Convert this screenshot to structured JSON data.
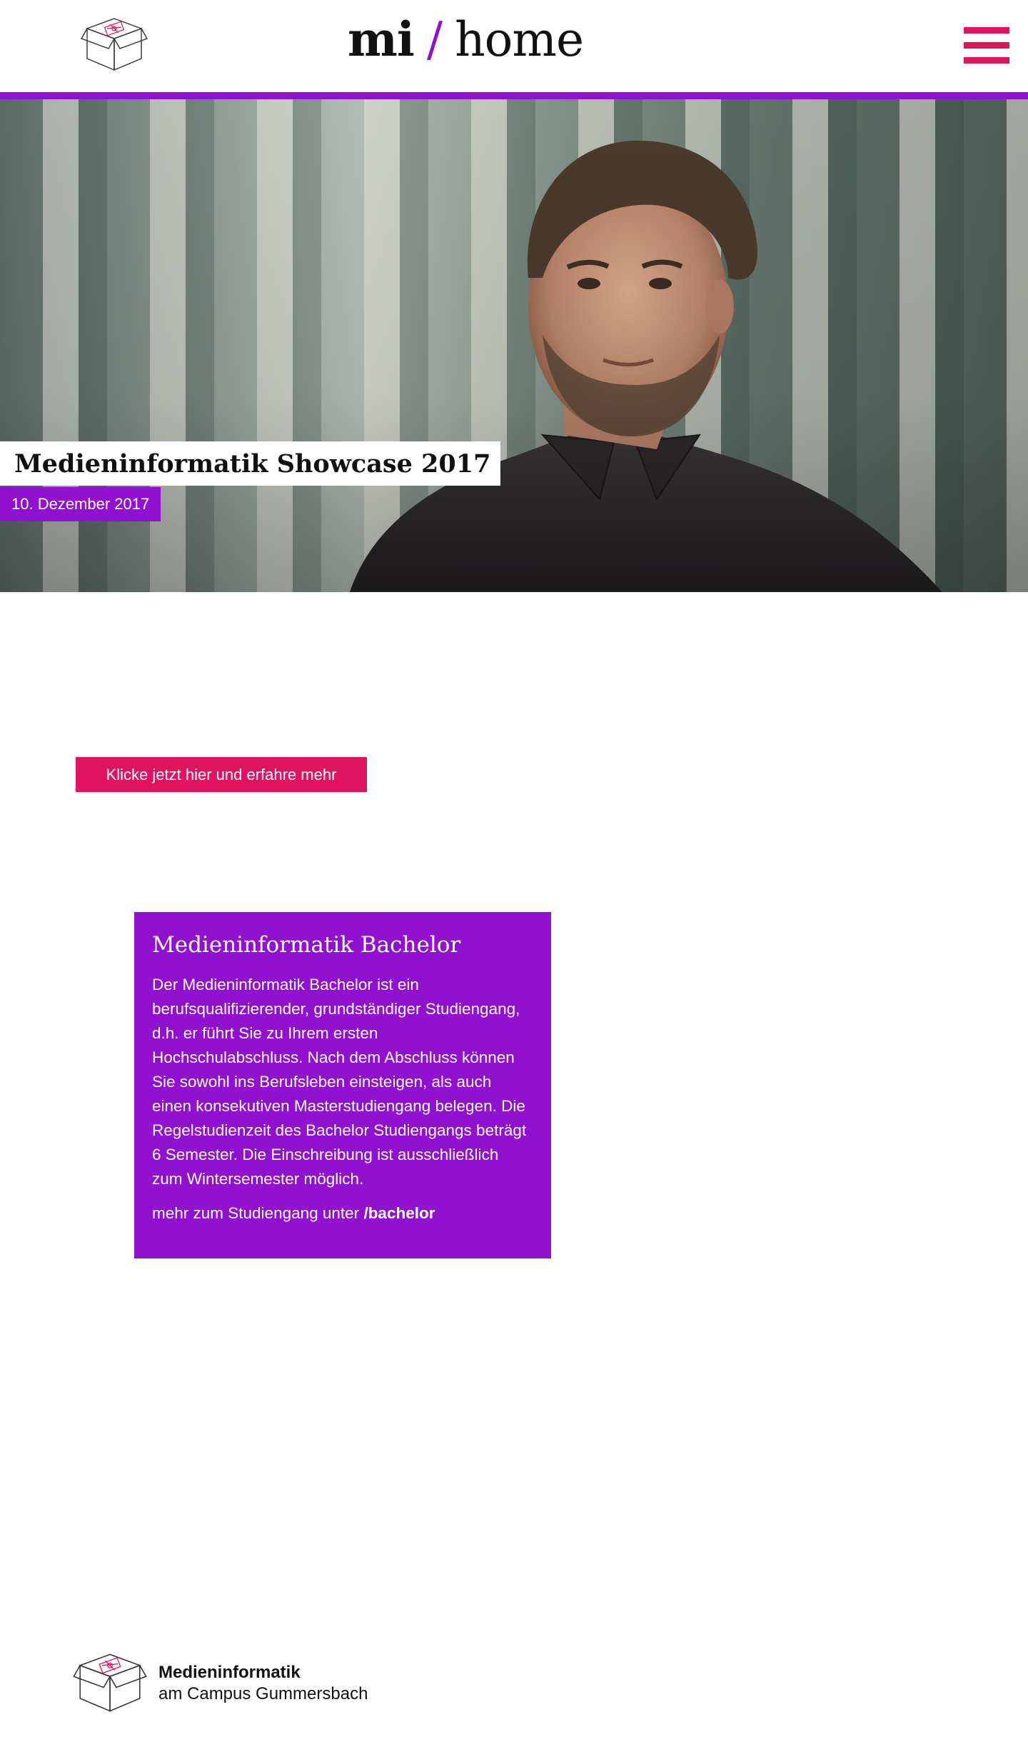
{
  "header": {
    "title_strong": "mi",
    "title_slash": "/",
    "title_light": "home"
  },
  "hero": {
    "title": "Medieninformatik Showcase 2017",
    "date": "10. Dezember 2017"
  },
  "cta": {
    "label": "Klicke jetzt hier und erfahre mehr"
  },
  "card": {
    "title": "Medieninformatik Bachelor",
    "text": "Der Medieninformatik Bachelor ist ein berufsqualifizierender, grundständiger Studiengang, d.h. er führt Sie zu Ihrem ersten Hochschulabschluss. Nach dem Abschluss können Sie sowohl ins Berufsleben einsteigen, als auch einen konsekutiven Masterstudiengang belegen. Die Regelstudienzeit des Bachelor Studiengangs beträgt 6 Semester. Die Einschreibung ist ausschließlich zum Wintersemester möglich.",
    "more_prefix": "mehr zum Studiengang unter",
    "more_link": "/bachelor"
  },
  "footer": {
    "name": "Medieninformatik",
    "subtitle": "am Campus Gummersbach"
  },
  "colors": {
    "accent_purple": "#9012d0",
    "accent_pink": "#e0135f"
  },
  "icons": {
    "logo": "box-logo-icon",
    "menu": "hamburger-menu-icon"
  }
}
